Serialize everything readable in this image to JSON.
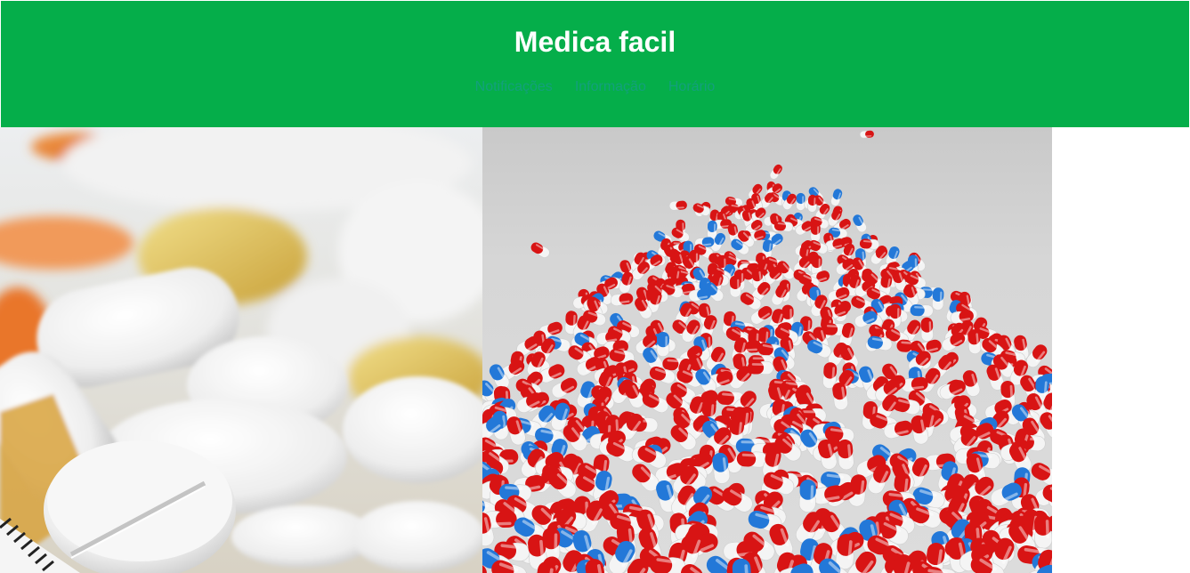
{
  "header": {
    "title": "Medica facil",
    "nav": [
      {
        "label": "Notificações"
      },
      {
        "label": "Informação"
      },
      {
        "label": "Horário"
      }
    ]
  },
  "colors": {
    "header_bg": "#05ae4a",
    "title": "#ffffff",
    "nav_link": "#13a07c",
    "capsule_red": "#d81414",
    "capsule_blue": "#2378d8",
    "capsule_white": "#f4f4f4"
  },
  "images": [
    {
      "name": "tablets-photo"
    },
    {
      "name": "capsules-photo"
    }
  ]
}
